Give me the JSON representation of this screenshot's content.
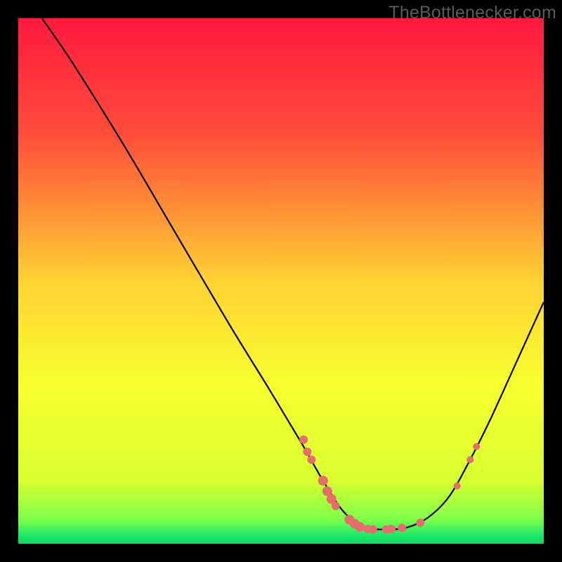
{
  "watermark": "TheBottlenecker.com",
  "chart_data": {
    "type": "line",
    "title": "",
    "xlabel": "",
    "ylabel": "",
    "xlim": [
      0,
      100
    ],
    "ylim": [
      0,
      100
    ],
    "gradient_stops": [
      {
        "offset": 0,
        "color": "#ff1a3f"
      },
      {
        "offset": 0.22,
        "color": "#ff4d3a"
      },
      {
        "offset": 0.5,
        "color": "#ffd233"
      },
      {
        "offset": 0.7,
        "color": "#f7ff2e"
      },
      {
        "offset": 0.88,
        "color": "#d8ff30"
      },
      {
        "offset": 0.955,
        "color": "#7dff4a"
      },
      {
        "offset": 0.985,
        "color": "#18e86a"
      },
      {
        "offset": 1.0,
        "color": "#0fd962"
      }
    ],
    "curve": [
      {
        "x": 4.5,
        "y": 100
      },
      {
        "x": 10,
        "y": 92
      },
      {
        "x": 20,
        "y": 76
      },
      {
        "x": 30,
        "y": 59
      },
      {
        "x": 40,
        "y": 42
      },
      {
        "x": 48,
        "y": 29
      },
      {
        "x": 54,
        "y": 19
      },
      {
        "x": 58,
        "y": 12
      },
      {
        "x": 62,
        "y": 6
      },
      {
        "x": 66,
        "y": 3.2
      },
      {
        "x": 70,
        "y": 2.7
      },
      {
        "x": 74,
        "y": 3.1
      },
      {
        "x": 78,
        "y": 5.0
      },
      {
        "x": 82,
        "y": 9.0
      },
      {
        "x": 86,
        "y": 16.0
      },
      {
        "x": 90,
        "y": 24.0
      },
      {
        "x": 95,
        "y": 35.0
      },
      {
        "x": 100,
        "y": 46.0
      }
    ],
    "markers": [
      {
        "x": 54.3,
        "y": 19.8,
        "r": 6
      },
      {
        "x": 55.0,
        "y": 17.5,
        "r": 6
      },
      {
        "x": 55.8,
        "y": 16.0,
        "r": 6
      },
      {
        "x": 58.0,
        "y": 12.0,
        "r": 7
      },
      {
        "x": 58.8,
        "y": 10.0,
        "r": 7
      },
      {
        "x": 59.6,
        "y": 8.5,
        "r": 7
      },
      {
        "x": 60.4,
        "y": 7.2,
        "r": 6
      },
      {
        "x": 63.0,
        "y": 4.6,
        "r": 7
      },
      {
        "x": 64.0,
        "y": 3.8,
        "r": 7
      },
      {
        "x": 65.0,
        "y": 3.2,
        "r": 7
      },
      {
        "x": 66.5,
        "y": 2.8,
        "r": 6
      },
      {
        "x": 67.5,
        "y": 2.7,
        "r": 6
      },
      {
        "x": 70.0,
        "y": 2.7,
        "r": 6
      },
      {
        "x": 71.0,
        "y": 2.8,
        "r": 6
      },
      {
        "x": 73.0,
        "y": 3.0,
        "r": 6
      },
      {
        "x": 76.5,
        "y": 4.0,
        "r": 6
      },
      {
        "x": 83.5,
        "y": 11.0,
        "r": 5
      },
      {
        "x": 86.0,
        "y": 16.0,
        "r": 5
      },
      {
        "x": 87.2,
        "y": 18.5,
        "r": 5
      }
    ],
    "marker_color": "#e46d6d"
  }
}
